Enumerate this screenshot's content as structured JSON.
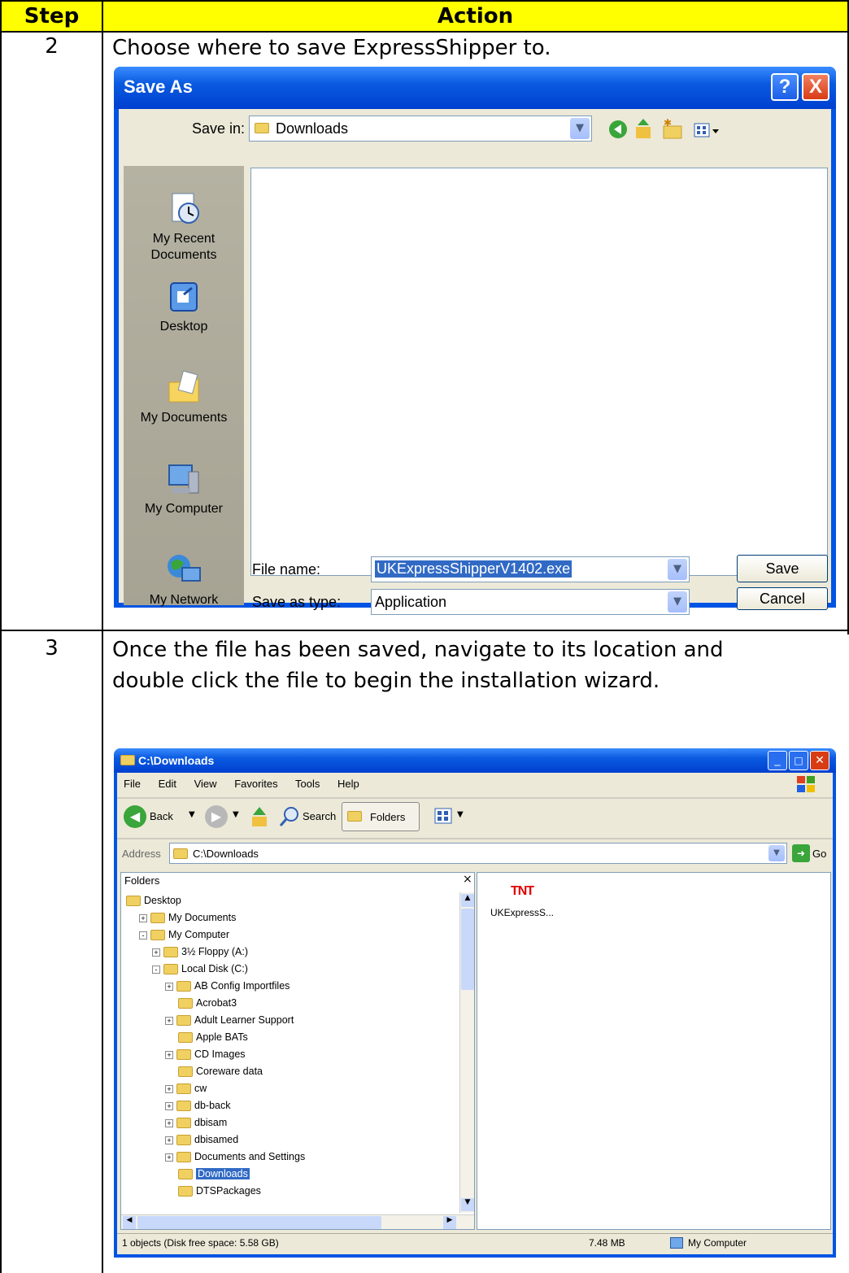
{
  "header": {
    "step": "Step",
    "action": "Action"
  },
  "rows": [
    {
      "step": "2",
      "text": "Choose where to save ExpressShipper to."
    },
    {
      "step": "3",
      "text_line1": "Once the file has been saved, navigate to its location and",
      "text_line2": "double click the file to begin the installation wizard."
    }
  ],
  "save_dialog": {
    "title": "Save As",
    "help_btn": "?",
    "close_btn": "X",
    "save_in_label": "Save in:",
    "save_in_value": "Downloads",
    "places": [
      "My Recent\nDocuments",
      "Desktop",
      "My Documents",
      "My Computer",
      "My Network"
    ],
    "place_recent_1": "My Recent",
    "place_recent_2": "Documents",
    "place_desktop": "Desktop",
    "place_mydocs": "My Documents",
    "place_mycomp": "My Computer",
    "place_network": "My Network",
    "file_name_label": "File name:",
    "file_name_value": "UKExpressShipperV1402.exe",
    "save_type_label": "Save as type:",
    "save_type_value": "Application",
    "save_btn": "Save",
    "cancel_btn": "Cancel"
  },
  "explorer": {
    "title": "C:\\Downloads",
    "menu": [
      "File",
      "Edit",
      "View",
      "Favorites",
      "Tools",
      "Help"
    ],
    "back": "Back",
    "search": "Search",
    "folders": "Folders",
    "address_label": "Address",
    "address_value": "C:\\Downloads",
    "go": "Go",
    "folders_pane_title": "Folders",
    "tree": [
      {
        "label": "Desktop",
        "level": 0,
        "expander": ""
      },
      {
        "label": "My Documents",
        "level": 1,
        "expander": "+"
      },
      {
        "label": "My Computer",
        "level": 1,
        "expander": "-"
      },
      {
        "label": "3½ Floppy (A:)",
        "level": 2,
        "expander": "+"
      },
      {
        "label": "Local Disk (C:)",
        "level": 2,
        "expander": "-"
      },
      {
        "label": "AB Config Importfiles",
        "level": 3,
        "expander": "+"
      },
      {
        "label": "Acrobat3",
        "level": 3,
        "expander": ""
      },
      {
        "label": "Adult Learner Support",
        "level": 3,
        "expander": "+"
      },
      {
        "label": "Apple BATs",
        "level": 3,
        "expander": ""
      },
      {
        "label": "CD Images",
        "level": 3,
        "expander": "+"
      },
      {
        "label": "Coreware data",
        "level": 3,
        "expander": ""
      },
      {
        "label": "cw",
        "level": 3,
        "expander": "+"
      },
      {
        "label": "db-back",
        "level": 3,
        "expander": "+"
      },
      {
        "label": "dbisam",
        "level": 3,
        "expander": "+"
      },
      {
        "label": "dbisamed",
        "level": 3,
        "expander": "+"
      },
      {
        "label": "Documents and Settings",
        "level": 3,
        "expander": "+"
      },
      {
        "label": "Downloads",
        "level": 3,
        "expander": "",
        "selected": true
      },
      {
        "label": "DTSPackages",
        "level": 3,
        "expander": ""
      }
    ],
    "file_logo": "TNT",
    "file_name": "UKExpressS...",
    "status_objects": "1 objects (Disk free space: 5.58 GB)",
    "status_size": "7.48 MB",
    "status_location": "My Computer"
  }
}
